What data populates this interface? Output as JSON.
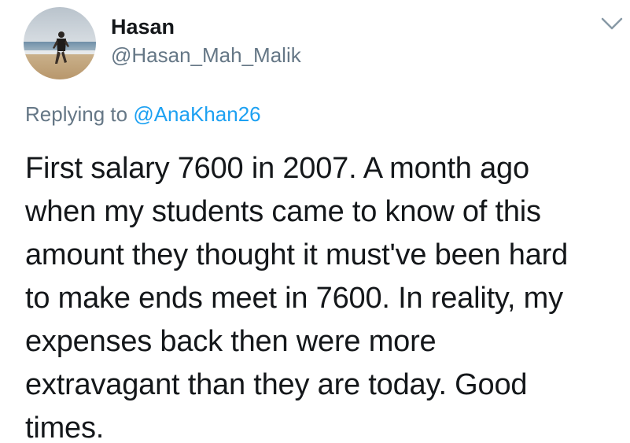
{
  "tweet": {
    "author": {
      "display_name": "Hasan",
      "handle": "@Hasan_Mah_Malik",
      "avatar": "profile-photo-beach-runner"
    },
    "menu_icon": "chevron-down-icon",
    "replying_to": {
      "prefix": "Replying to",
      "mention": "@AnaKhan26"
    },
    "text_lines": [
      "First salary 7600 in 2007. A month ago",
      "when my students came to know of this",
      "amount they thought it must've been hard",
      "to make ends meet in 7600. In reality, my",
      "expenses back then were more",
      "extravagant than they are today. Good",
      "times."
    ]
  },
  "colors": {
    "primary_text": "#14171a",
    "secondary_text": "#657786",
    "link": "#1da1f2",
    "background": "#ffffff"
  }
}
